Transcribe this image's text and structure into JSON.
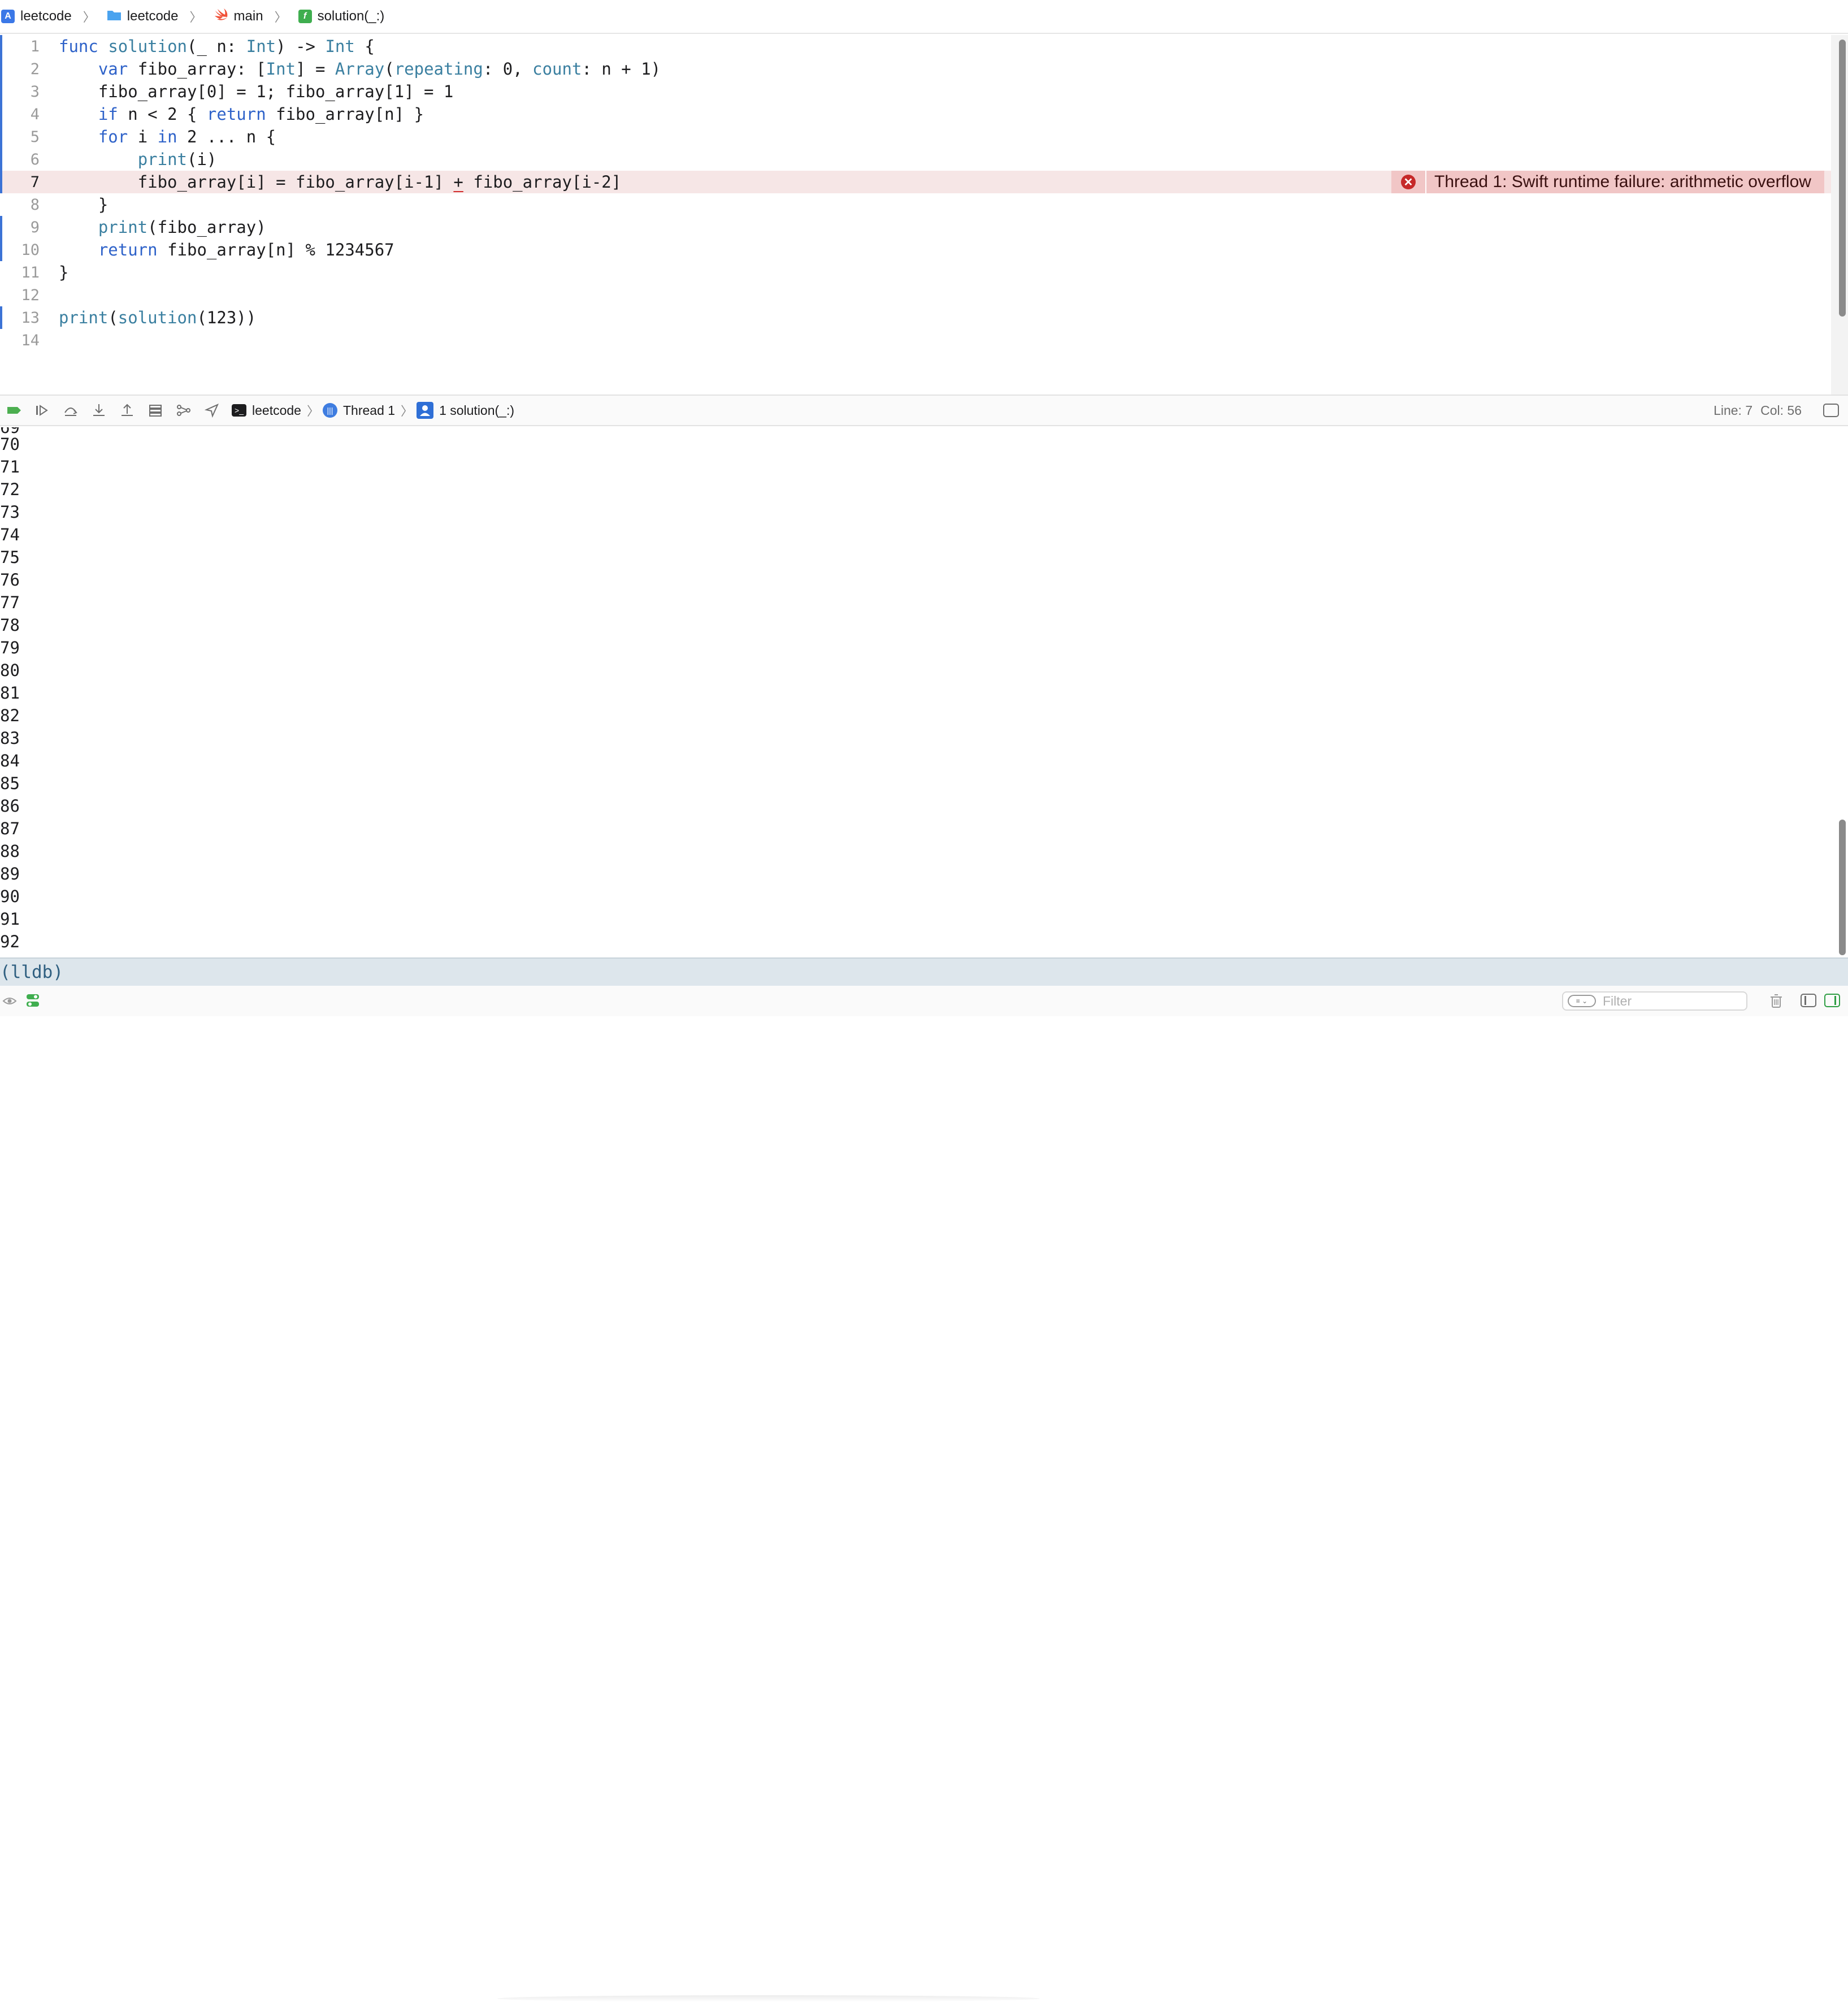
{
  "breadcrumb": [
    {
      "label": "leetcode",
      "icon": "app-icon"
    },
    {
      "label": "leetcode",
      "icon": "folder-icon"
    },
    {
      "label": "main",
      "icon": "swift-icon"
    },
    {
      "label": "solution(_:)",
      "icon": "function-icon"
    }
  ],
  "editor": {
    "current_line": 7,
    "lines": [
      {
        "n": "1"
      },
      {
        "n": "2"
      },
      {
        "n": "3"
      },
      {
        "n": "4"
      },
      {
        "n": "5"
      },
      {
        "n": "6"
      },
      {
        "n": "7"
      },
      {
        "n": "8"
      },
      {
        "n": "9"
      },
      {
        "n": "10"
      },
      {
        "n": "11"
      },
      {
        "n": "12"
      },
      {
        "n": "13"
      },
      {
        "n": "14"
      }
    ],
    "code_tokens": {
      "l1": [
        "func",
        "solution",
        "(_ n: ",
        "Int",
        ") -> ",
        "Int",
        " {"
      ],
      "l2": [
        "    ",
        "var",
        " fibo_array: [",
        "Int",
        "] = ",
        "Array",
        "(",
        "repeating",
        ": 0, ",
        "count",
        ": n + 1)"
      ],
      "l3": [
        "    fibo_array[0] = 1; fibo_array[1] = 1"
      ],
      "l4": [
        "    ",
        "if",
        " n < 2 { ",
        "return",
        " fibo_array[n] }"
      ],
      "l5": [
        "    ",
        "for",
        " i ",
        "in",
        " 2 ... n {"
      ],
      "l6": [
        "        ",
        "print",
        "(i)"
      ],
      "l7": [
        "        fibo_array[i] = fibo_array[i-1] ",
        "+",
        " fibo_array[i-2]"
      ],
      "l8": [
        "    }"
      ],
      "l9": [
        "    ",
        "print",
        "(fibo_array)"
      ],
      "l10": [
        "    ",
        "return",
        " fibo_array[n] % 1234567"
      ],
      "l11": [
        "}"
      ],
      "l12": [
        ""
      ],
      "l13": [
        "print",
        "(",
        "solution",
        "(123))"
      ],
      "l14": [
        ""
      ]
    },
    "error_message": "Thread 1: Swift runtime failure: arithmetic overflow"
  },
  "debug_bar": {
    "process": "leetcode",
    "thread": "Thread 1",
    "frame": "1 solution(_:)",
    "line_label": "Line: 7",
    "col_label": "Col: 56"
  },
  "console": {
    "output": [
      "70",
      "71",
      "72",
      "73",
      "74",
      "75",
      "76",
      "77",
      "78",
      "79",
      "80",
      "81",
      "82",
      "83",
      "84",
      "85",
      "86",
      "87",
      "88",
      "89",
      "90",
      "91",
      "92"
    ],
    "prompt": "(lldb)"
  },
  "bottom_bar": {
    "filter_placeholder": "Filter"
  },
  "colors": {
    "keyword": "#2e62c9",
    "type": "#3a7fa0",
    "error_bg": "#f1c6c6",
    "error_line_bg": "#f6e6e6",
    "lldb_bg": "#dde6ec"
  }
}
